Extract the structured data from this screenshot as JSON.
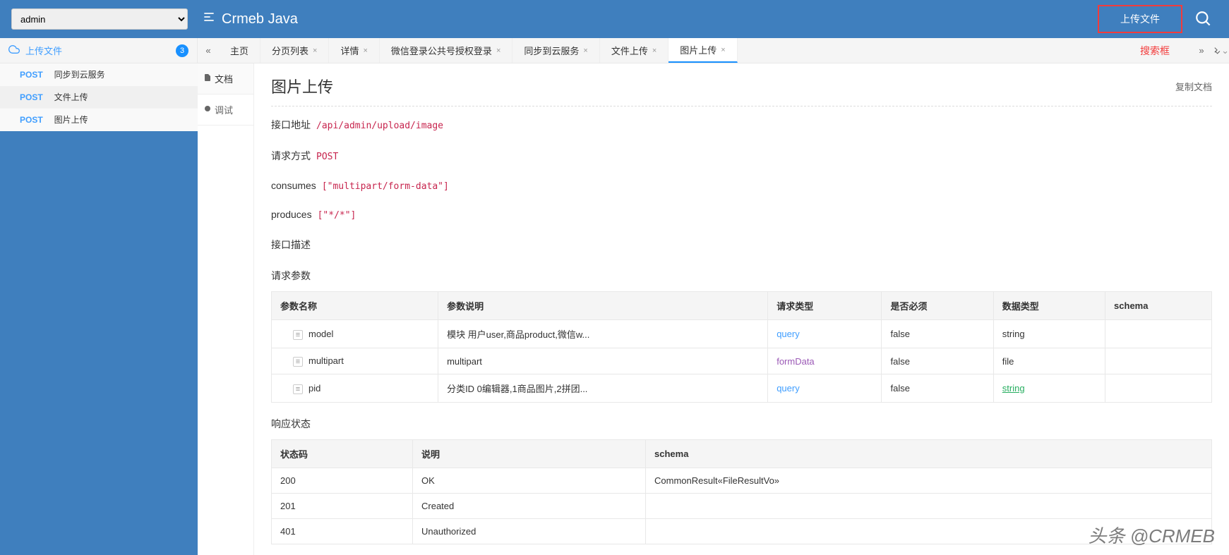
{
  "header": {
    "select_value": "admin",
    "app_name": "Crmeb Java",
    "upload_btn": "上传文件"
  },
  "sidebar_header": {
    "title": "上传文件",
    "badge": "3"
  },
  "tabs": {
    "home": "主页",
    "items": [
      {
        "label": "分页列表"
      },
      {
        "label": "详情"
      },
      {
        "label": "微信登录公共号授权登录"
      },
      {
        "label": "同步到云服务"
      },
      {
        "label": "文件上传"
      },
      {
        "label": "图片上传"
      }
    ]
  },
  "search_annotation": "搜索框",
  "sidebar": {
    "items": [
      {
        "method": "POST",
        "name": "同步到云服务"
      },
      {
        "method": "POST",
        "name": "文件上传"
      },
      {
        "method": "POST",
        "name": "图片上传"
      }
    ]
  },
  "vtabs": {
    "doc": "文档",
    "debug": "调试"
  },
  "doc": {
    "title": "图片上传",
    "copy_label": "复制文档",
    "url_label": "接口地址",
    "url_value": "/api/admin/upload/image",
    "method_label": "请求方式",
    "method_value": "POST",
    "consumes_label": "consumes",
    "consumes_value": "[\"multipart/form-data\"]",
    "produces_label": "produces",
    "produces_value": "[\"*/*\"]",
    "desc_label": "接口描述",
    "req_params_label": "请求参数",
    "resp_status_label": "响应状态"
  },
  "params_table": {
    "headers": {
      "name": "参数名称",
      "desc": "参数说明",
      "req_type": "请求类型",
      "required": "是否必须",
      "data_type": "数据类型",
      "schema": "schema"
    },
    "rows": [
      {
        "name": "model",
        "desc": "模块 用户user,商品product,微信w...",
        "req_type": "query",
        "required": "false",
        "data_type": "string",
        "data_type_class": "data-string",
        "schema": ""
      },
      {
        "name": "multipart",
        "desc": "multipart",
        "req_type": "formData",
        "req_type_class": "link-purple",
        "required": "false",
        "data_type": "file",
        "data_type_class": "data-string",
        "schema": ""
      },
      {
        "name": "pid",
        "desc": "分类ID 0编辑器,1商品图片,2拼团...",
        "req_type": "query",
        "required": "false",
        "data_type": "string",
        "data_type_class": "link-green",
        "schema": ""
      }
    ]
  },
  "status_table": {
    "headers": {
      "code": "状态码",
      "desc": "说明",
      "schema": "schema"
    },
    "rows": [
      {
        "code": "200",
        "desc": "OK",
        "schema": "CommonResult«FileResultVo»"
      },
      {
        "code": "201",
        "desc": "Created",
        "schema": ""
      },
      {
        "code": "401",
        "desc": "Unauthorized",
        "schema": ""
      }
    ]
  },
  "watermark": "头条 @CRMEB"
}
